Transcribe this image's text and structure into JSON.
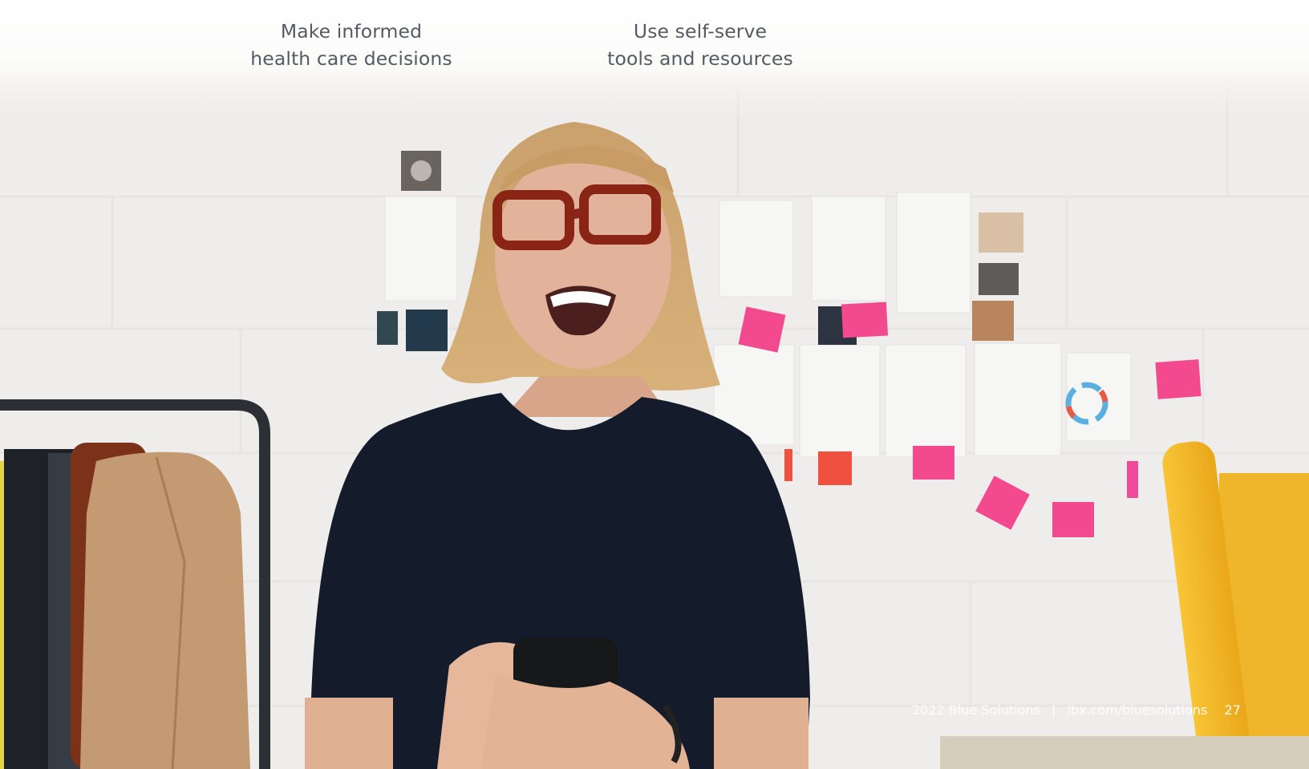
{
  "captions": [
    {
      "line1": "Make informed",
      "line2": "health care decisions"
    },
    {
      "line1": "Use self-serve",
      "line2": "tools and resources"
    }
  ],
  "footer": {
    "publication": "2022 Blue Solutions",
    "separator": "|",
    "url": "ibx.com/bluesolutions",
    "page_number": "27"
  },
  "colors": {
    "caption_text": "#555b63",
    "wall": "#efeeec",
    "sweater": "#141c2c",
    "sticky_note_pink": "#f2498f",
    "paper_roll_yellow": "#f5b82a",
    "footer_text": "#ffffff"
  }
}
